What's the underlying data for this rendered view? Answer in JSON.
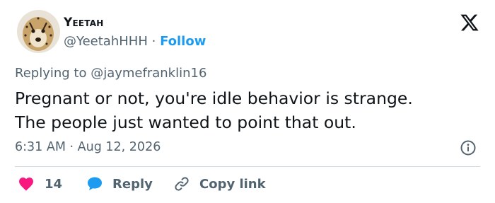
{
  "author": {
    "name": "Yeetah",
    "handle": "@YeetahHHH",
    "separator": "·",
    "follow_label": "Follow"
  },
  "reply_context": {
    "prefix": "Replying to",
    "mention": "@jaymefranklin16"
  },
  "tweet": {
    "lines": [
      "Pregnant or not, you're idle behavior is strange.",
      "The people just wanted to point that out."
    ]
  },
  "meta": {
    "time": "6:31 AM",
    "separator": "·",
    "date": "Aug 12, 2026"
  },
  "actions": {
    "like_count": "14",
    "reply_label": "Reply",
    "copy_link_label": "Copy link"
  },
  "colors": {
    "like": "#f91880",
    "reply": "#1d9bf0",
    "link": "#1d9bf0",
    "muted": "#536471",
    "text": "#0f1419"
  },
  "icons": [
    "cheetah-avatar",
    "x-logo-icon",
    "info-icon",
    "heart-icon",
    "reply-bubble-icon",
    "link-icon"
  ]
}
